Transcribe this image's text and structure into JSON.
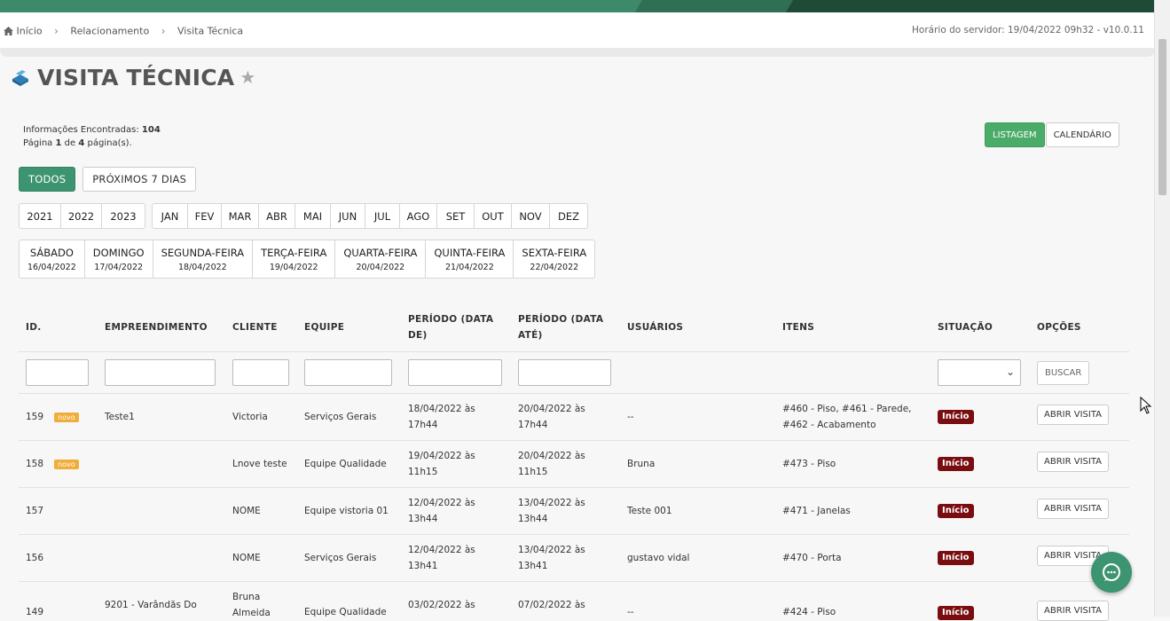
{
  "breadcrumb": [
    "Início",
    "Relacionamento",
    "Visita Técnica"
  ],
  "server_time": "Horário do servidor: 19/04/2022 09h32 - v10.0.11",
  "page_title": "VISITA TÉCNICA",
  "info": {
    "found_label": "Informações Encontradas:",
    "found_count": "104",
    "page_prefix": "Página",
    "page_current": "1",
    "page_mid": "de",
    "page_total": "4",
    "page_suffix": "página(s)."
  },
  "view_buttons": {
    "listagem": "LISTAGEM",
    "calendario": "CALENDÁRIO"
  },
  "filters": {
    "todos": "TODOS",
    "proximos": "PRÓXIMOS 7 DIAS"
  },
  "years": [
    "2021",
    "2022",
    "2023"
  ],
  "months": [
    "JAN",
    "FEV",
    "MAR",
    "ABR",
    "MAI",
    "JUN",
    "JUL",
    "AGO",
    "SET",
    "OUT",
    "NOV",
    "DEZ"
  ],
  "days": [
    {
      "name": "SÁBADO",
      "date": "16/04/2022"
    },
    {
      "name": "DOMINGO",
      "date": "17/04/2022"
    },
    {
      "name": "SEGUNDA-FEIRA",
      "date": "18/04/2022"
    },
    {
      "name": "TERÇA-FEIRA",
      "date": "19/04/2022"
    },
    {
      "name": "QUARTA-FEIRA",
      "date": "20/04/2022"
    },
    {
      "name": "QUINTA-FEIRA",
      "date": "21/04/2022"
    },
    {
      "name": "SEXTA-FEIRA",
      "date": "22/04/2022"
    }
  ],
  "table": {
    "headers": {
      "id": "ID.",
      "empreendimento": "EMPREENDIMENTO",
      "cliente": "CLIENTE",
      "equipe": "EQUIPE",
      "periodo_de_1": "PERÍODO (DATA",
      "periodo_de_2": "DE)",
      "periodo_ate_1": "PERÍODO (DATA",
      "periodo_ate_2": "ATÉ)",
      "usuarios": "USUÁRIOS",
      "itens": "ITENS",
      "situacao": "SITUAÇÃO",
      "opcoes": "OPÇÕES"
    },
    "search_label": "BUSCAR",
    "new_badge": "novo",
    "status_label": "Início",
    "open_label": "ABRIR VISITA",
    "rows": [
      {
        "id": "159",
        "novo": true,
        "emp1": "Teste1",
        "emp2": "",
        "cli1": "Victoria",
        "cli2": "",
        "equipe": "Serviços Gerais",
        "de1": "18/04/2022 às",
        "de2": "17h44",
        "ate1": "20/04/2022 às",
        "ate2": "17h44",
        "usuarios": "--",
        "itens1": "#460 - Piso, #461 - Parede,",
        "itens2": "#462 - Acabamento"
      },
      {
        "id": "158",
        "novo": true,
        "emp1": "",
        "emp2": "",
        "cli1": "Lnove teste",
        "cli2": "",
        "equipe": "Equipe Qualidade",
        "de1": "19/04/2022 às",
        "de2": "11h15",
        "ate1": "20/04/2022 às",
        "ate2": "11h15",
        "usuarios": "Bruna",
        "itens1": "#473 - Piso",
        "itens2": ""
      },
      {
        "id": "157",
        "novo": false,
        "emp1": "",
        "emp2": "",
        "cli1": "NOME",
        "cli2": "",
        "equipe": "Equipe vistoria 01",
        "de1": "12/04/2022 às",
        "de2": "13h44",
        "ate1": "13/04/2022 às",
        "ate2": "13h44",
        "usuarios": "Teste 001",
        "itens1": "#471 - Janelas",
        "itens2": ""
      },
      {
        "id": "156",
        "novo": false,
        "emp1": "",
        "emp2": "",
        "cli1": "NOME",
        "cli2": "",
        "equipe": "Serviços Gerais",
        "de1": "12/04/2022 às",
        "de2": "13h41",
        "ate1": "13/04/2022 às",
        "ate2": "13h41",
        "usuarios": "gustavo vidal",
        "itens1": "#470 - Porta",
        "itens2": ""
      },
      {
        "id": "149",
        "novo": false,
        "emp1": "9201 - Varândãs Do",
        "emp2": "",
        "cli1": "Bruna",
        "cli2": "Almeida",
        "equipe": "Equipe Qualidade",
        "de1": "03/02/2022 às",
        "de2": "",
        "ate1": "07/02/2022 às",
        "ate2": "",
        "usuarios": "--",
        "itens1": "#424 - Piso",
        "itens2": ""
      }
    ]
  },
  "colors": {
    "primary_green": "#3c9470",
    "listagem_green": "#4bab69",
    "status_red": "#7a0d10",
    "novo_orange": "#f0ad3a"
  }
}
